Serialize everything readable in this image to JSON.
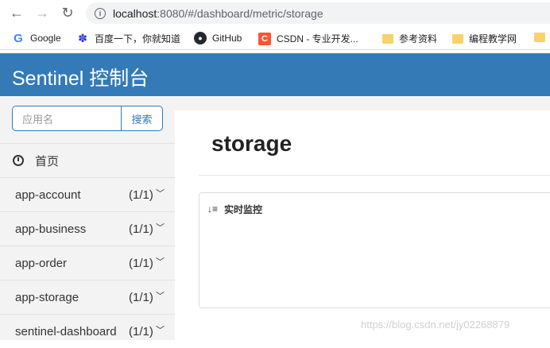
{
  "browser": {
    "url_host": "localhost",
    "url_rest": ":8080/#/dashboard/metric/storage",
    "bookmarks": [
      {
        "label": "Google",
        "icon": "google-icon"
      },
      {
        "label": "百度一下，你就知道",
        "icon": "baidu-icon"
      },
      {
        "label": "GitHub",
        "icon": "github-icon"
      },
      {
        "label": "CSDN - 专业开发...",
        "icon": "csdn-icon"
      },
      {
        "label": "参考资料",
        "icon": "folder-icon"
      },
      {
        "label": "编程教学网",
        "icon": "folder-icon"
      }
    ]
  },
  "header": {
    "title": "Sentinel 控制台",
    "bg_color": "#337ab7"
  },
  "sidebar": {
    "search_placeholder": "应用名",
    "search_button": "搜索",
    "home_label": "首页",
    "apps": [
      {
        "name": "app-account",
        "count": "(1/1)"
      },
      {
        "name": "app-business",
        "count": "(1/1)"
      },
      {
        "name": "app-order",
        "count": "(1/1)"
      },
      {
        "name": "app-storage",
        "count": "(1/1)"
      },
      {
        "name": "sentinel-dashboard",
        "count": "(1/1)"
      }
    ]
  },
  "main": {
    "title": "storage",
    "panel_title": "实时监控"
  },
  "watermark": "https://blog.csdn.net/jy02268879"
}
